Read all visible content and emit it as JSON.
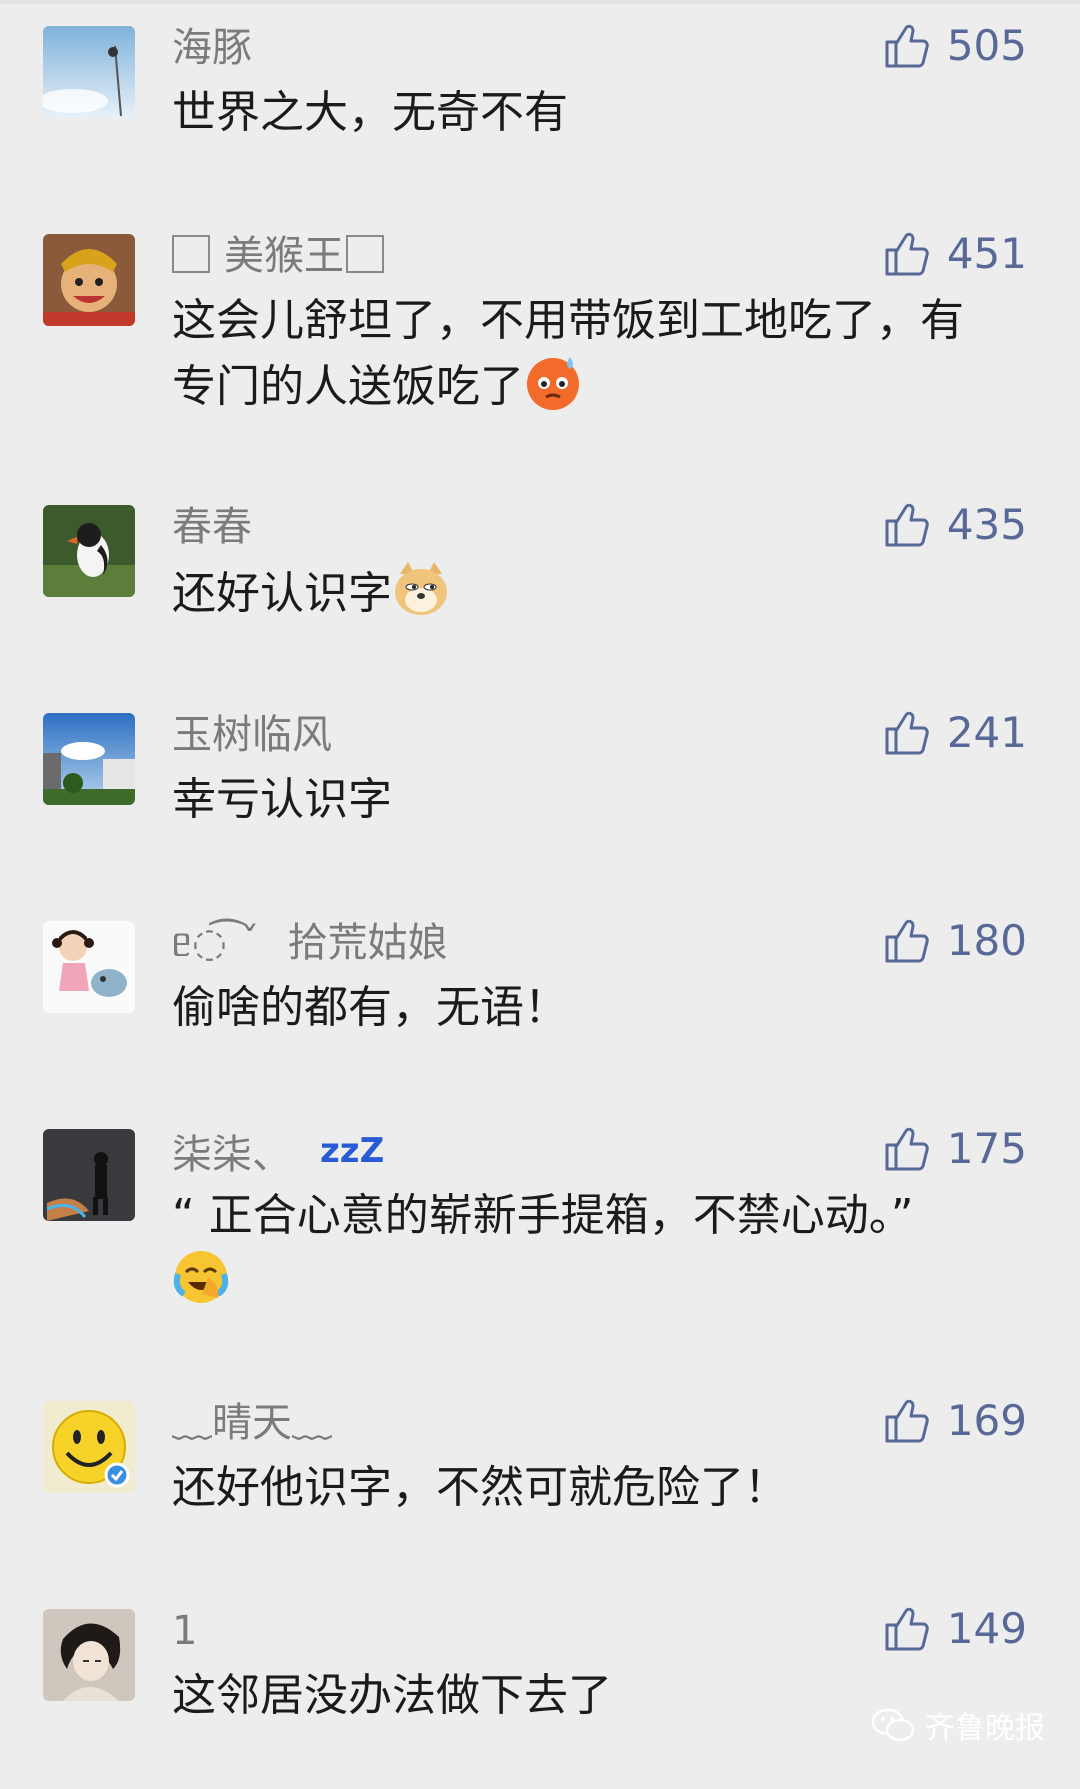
{
  "comments": [
    {
      "name": "海豚",
      "likes": "505",
      "text": "世界之大，无奇不有"
    },
    {
      "name": "美猴王",
      "likes": "451",
      "text": "这会儿舒坦了，不用带饭到工地吃了，有专门的人送饭吃了"
    },
    {
      "name": "春春",
      "likes": "435",
      "text": "还好认识字"
    },
    {
      "name": "玉树临风",
      "likes": "241",
      "text": "幸亏认识字"
    },
    {
      "name": "拾荒姑娘",
      "name_prefix": "ᥱ◌͡ ˇ",
      "likes": "180",
      "text": "偷啥的都有，无语！"
    },
    {
      "name": "柒柒、",
      "name_suffix": "zzZ",
      "likes": "175",
      "text": "“ 正合心意的崭新手提箱，不禁心动。”"
    },
    {
      "name": "﹏晴天﹏",
      "likes": "169",
      "text": "还好他识字，不然可就危险了！"
    },
    {
      "name": "1",
      "likes": "149",
      "text": "这邻居没办法做下去了"
    }
  ],
  "watermark": {
    "text": "齐鲁晚报"
  },
  "colors": {
    "background": "#ededed",
    "like_blue": "#586897",
    "name_gray": "#7b7b7b"
  },
  "icons": {
    "like": "thumbs-up-icon",
    "watermark": "wechat-icon"
  }
}
